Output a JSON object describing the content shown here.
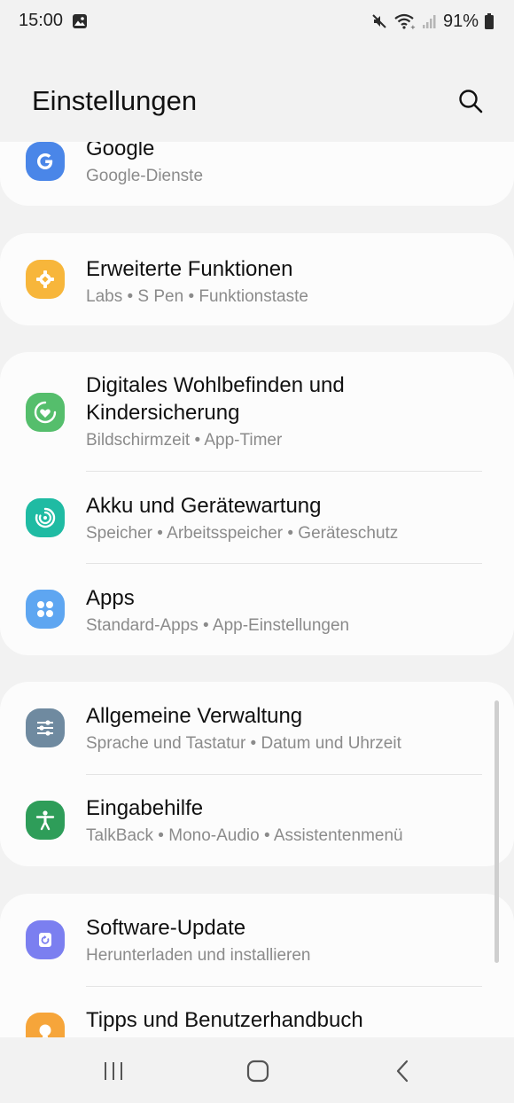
{
  "status_bar": {
    "time": "15:00",
    "battery": "91%"
  },
  "header": {
    "title": "Einstellungen"
  },
  "items": [
    {
      "title": "Google",
      "subtitle": "Google-Dienste",
      "icon": "google-icon",
      "color": "#4a86e8"
    },
    {
      "title": "Erweiterte Funktionen",
      "subtitle": "Labs  •  S Pen  •  Funktionstaste",
      "icon": "puzzle-gear-icon",
      "color": "#f7b63b"
    },
    {
      "title": "Digitales Wohlbefinden und Kindersicherung",
      "subtitle": "Bildschirmzeit  •  App-Timer",
      "icon": "heart-circle-icon",
      "color": "#55be6c"
    },
    {
      "title": "Akku und Gerätewartung",
      "subtitle": "Speicher  •  Arbeitsspeicher  •  Geräteschutz",
      "icon": "device-care-icon",
      "color": "#1fbba3"
    },
    {
      "title": "Apps",
      "subtitle": "Standard-Apps  •  App-Einstellungen",
      "icon": "apps-grid-icon",
      "color": "#5ea6f1"
    },
    {
      "title": "Allgemeine Verwaltung",
      "subtitle": "Sprache und Tastatur  •  Datum und Uhrzeit",
      "icon": "sliders-icon",
      "color": "#6f8aa0"
    },
    {
      "title": "Eingabehilfe",
      "subtitle": "TalkBack  •  Mono-Audio  •  Assistentenmenü",
      "icon": "accessibility-icon",
      "color": "#2e9d59"
    },
    {
      "title": "Software-Update",
      "subtitle": "Herunterladen und installieren",
      "icon": "software-update-icon",
      "color": "#7b7ff0"
    },
    {
      "title": "Tipps und Benutzerhandbuch",
      "subtitle": "",
      "icon": "lightbulb-icon",
      "color": "#f6a53a"
    }
  ]
}
